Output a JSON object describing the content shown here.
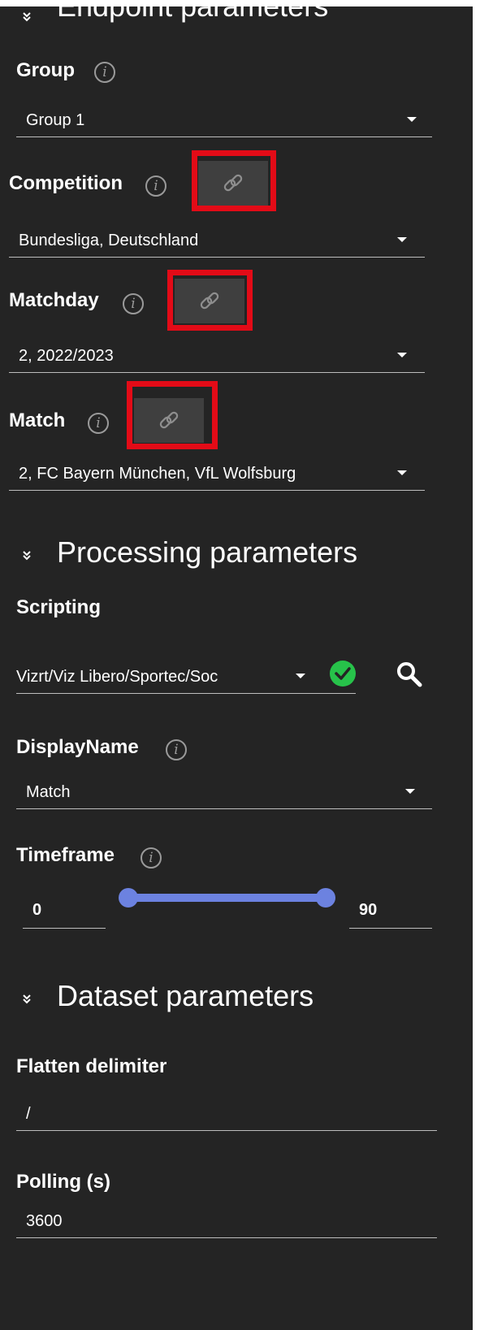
{
  "sections": {
    "endpoint": {
      "title": "Endpoint parameters"
    },
    "processing": {
      "title": "Processing parameters"
    },
    "dataset": {
      "title": "Dataset parameters"
    }
  },
  "fields": {
    "group": {
      "label": "Group",
      "value": "Group 1"
    },
    "competition": {
      "label": "Competition",
      "value": "Bundesliga, Deutschland"
    },
    "matchday": {
      "label": "Matchday",
      "value": "2, 2022/2023"
    },
    "match": {
      "label": "Match",
      "value": "2, FC Bayern München, VfL Wolfsburg"
    },
    "scripting": {
      "label": "Scripting",
      "value": "Vizrt/Viz Libero/Sportec/Soc",
      "status": "valid"
    },
    "display_name": {
      "label": "DisplayName",
      "value": "Match"
    },
    "timeframe": {
      "label": "Timeframe",
      "min": "0",
      "max": "90"
    },
    "flatten_delimiter": {
      "label": "Flatten delimiter",
      "value": "/"
    },
    "polling": {
      "label": "Polling (s)",
      "value": "3600"
    }
  },
  "icons": {
    "info": "i",
    "link": "link-icon",
    "search": "search-icon",
    "check": "check-circle-icon"
  },
  "colors": {
    "panel_bg": "#242424",
    "highlight": "#e30b17",
    "slider": "#6c82e0",
    "check": "#27c24a"
  }
}
